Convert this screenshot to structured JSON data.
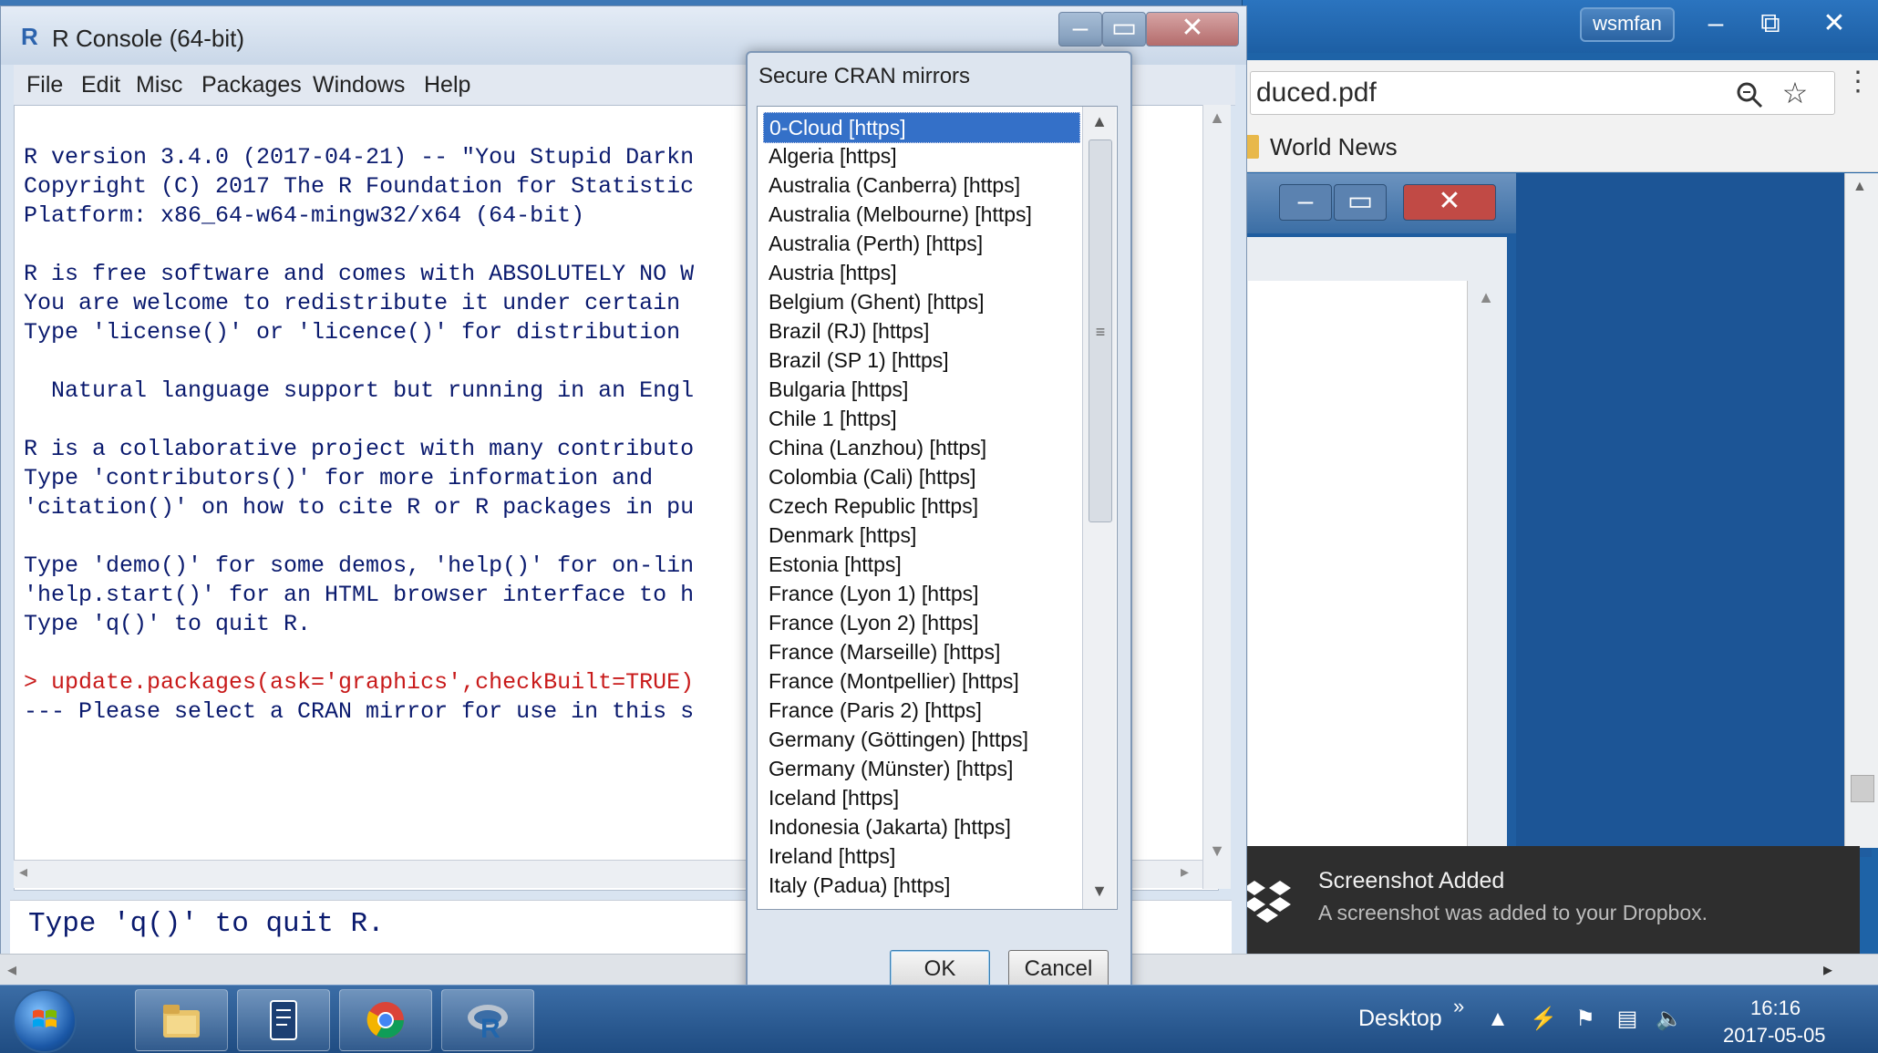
{
  "r_console": {
    "title": "R Console (64-bit)",
    "menus": [
      "File",
      "Edit",
      "Misc",
      "Packages",
      "Windows",
      "Help"
    ],
    "console_lines": [
      "",
      "R version 3.4.0 (2017-04-21) -- \"You Stupid Darkn",
      "Copyright (C) 2017 The R Foundation for Statistic",
      "Platform: x86_64-w64-mingw32/x64 (64-bit)",
      "",
      "R is free software and comes with ABSOLUTELY NO W",
      "You are welcome to redistribute it under certain",
      "Type 'license()' or 'licence()' for distribution",
      "",
      "  Natural language support but running in an Engl",
      "",
      "R is a collaborative project with many contributo",
      "Type 'contributors()' for more information and",
      "'citation()' on how to cite R or R packages in pu",
      "",
      "Type 'demo()' for some demos, 'help()' for on-lin",
      "'help.start()' for an HTML browser interface to h",
      "Type 'q()' to quit R.",
      "",
      "> update.packages(ask='graphics',checkBuilt=TRUE)",
      "--- Please select a CRAN mirror for use in this s"
    ],
    "lower_echo": "Type 'q()' to quit R."
  },
  "cran_dialog": {
    "title": "Secure CRAN mirrors",
    "selected_index": 0,
    "mirrors": [
      "0-Cloud [https]",
      "Algeria [https]",
      "Australia (Canberra) [https]",
      "Australia (Melbourne) [https]",
      "Australia (Perth) [https]",
      "Austria [https]",
      "Belgium (Ghent) [https]",
      "Brazil (RJ) [https]",
      "Brazil (SP 1) [https]",
      "Bulgaria [https]",
      "Chile 1 [https]",
      "China (Lanzhou) [https]",
      "Colombia (Cali) [https]",
      "Czech Republic [https]",
      "Denmark [https]",
      "Estonia [https]",
      "France (Lyon 1) [https]",
      "France (Lyon 2) [https]",
      "France (Marseille) [https]",
      "France (Montpellier) [https]",
      "France (Paris 2) [https]",
      "Germany (Göttingen) [https]",
      "Germany (Münster) [https]",
      "Iceland [https]",
      "Indonesia (Jakarta) [https]",
      "Ireland [https]",
      "Italy (Padua) [https]"
    ],
    "ok_label": "OK",
    "cancel_label": "Cancel"
  },
  "browser": {
    "profile_badge": "wsmfan",
    "url_text": "duced.pdf",
    "bookmark": "World News"
  },
  "dropbox_toast": {
    "title": "Screenshot Added",
    "body": "A screenshot was added to your Dropbox."
  },
  "taskbar": {
    "desktop_label": "Desktop",
    "chevron": "»",
    "time": "16:16",
    "date": "2017-05-05",
    "apps": [
      "file-explorer",
      "notepad-plus",
      "chrome",
      "r-gui"
    ]
  },
  "colors": {
    "selection": "#3470c8",
    "console_text": "#0a1a6e",
    "console_command": "#c81a1a",
    "taskbar": "#1f4c82"
  }
}
